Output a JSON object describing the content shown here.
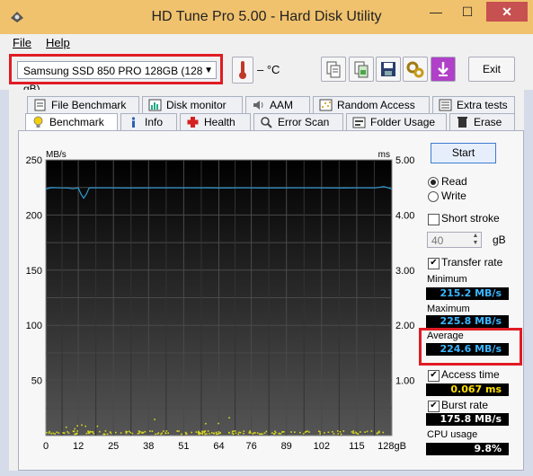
{
  "window": {
    "title": "HD Tune Pro 5.00 - Hard Disk Utility",
    "minimize": "—",
    "maximize": "☐",
    "close": "✕"
  },
  "menu": {
    "file": "File",
    "help": "Help"
  },
  "toolbar": {
    "drive": "Samsung SSD 850 PRO 128GB (128 gB)",
    "temperature": "– °C",
    "exit_label": "Exit",
    "icons": [
      "copy-text-icon",
      "copy-screenshot-icon",
      "save-icon",
      "options-icon",
      "download-icon"
    ]
  },
  "tabs_row1": [
    {
      "label": "File Benchmark",
      "icon": "file-benchmark-icon"
    },
    {
      "label": "Disk monitor",
      "icon": "disk-monitor-icon"
    },
    {
      "label": "AAM",
      "icon": "speaker-icon"
    },
    {
      "label": "Random Access",
      "icon": "random-access-icon"
    },
    {
      "label": "Extra tests",
      "icon": "extra-tests-icon"
    }
  ],
  "tabs_row2": [
    {
      "label": "Benchmark",
      "icon": "lightbulb-icon",
      "active": true
    },
    {
      "label": "Info",
      "icon": "info-icon"
    },
    {
      "label": "Health",
      "icon": "health-cross-icon"
    },
    {
      "label": "Error Scan",
      "icon": "error-scan-icon"
    },
    {
      "label": "Folder Usage",
      "icon": "folder-icon"
    },
    {
      "label": "Erase",
      "icon": "trash-icon"
    }
  ],
  "controls": {
    "start": "Start",
    "read": "Read",
    "write": "Write",
    "short_stroke": "Short stroke",
    "short_stroke_value": "40",
    "short_stroke_unit": "gB",
    "transfer_rate": "Transfer rate",
    "access_time": "Access time",
    "burst_rate": "Burst rate"
  },
  "stats": {
    "minimum_label": "Minimum",
    "minimum": "215.2 MB/s",
    "maximum_label": "Maximum",
    "maximum": "225.8 MB/s",
    "average_label": "Average",
    "average": "224.6 MB/s",
    "access_time": "0.067 ms",
    "burst_rate": "175.8 MB/s",
    "cpu_label": "CPU usage",
    "cpu": "9.8%"
  },
  "colors": {
    "transfer_line": "#2e9bd6",
    "access_dots": "#d8d820",
    "highlight": "#e01b24",
    "chart_bg": "#0b0b0b"
  },
  "chart_data": {
    "type": "line",
    "left_unit": "MB/s",
    "right_unit": "ms",
    "y_left_ticks": [
      "250",
      "200",
      "150",
      "100",
      "50"
    ],
    "y_left_range": [
      0,
      250
    ],
    "y_right_ticks": [
      "5.00",
      "4.00",
      "3.00",
      "2.00",
      "1.00"
    ],
    "y_right_range": [
      0,
      5
    ],
    "x_ticks": [
      "0",
      "12",
      "25",
      "38",
      "51",
      "64",
      "76",
      "89",
      "102",
      "115",
      "128gB"
    ],
    "x_range": [
      0,
      128
    ],
    "series": [
      {
        "x": [
          0,
          2,
          5,
          8,
          10,
          12,
          13,
          14,
          15,
          16,
          17,
          20,
          25,
          30,
          38,
          45,
          51,
          60,
          64,
          70,
          76,
          80,
          89,
          95,
          102,
          108,
          115,
          122,
          125,
          128
        ],
        "y": [
          223.5,
          224.8,
          224.6,
          224.5,
          223.8,
          224.6,
          219,
          215.2,
          219,
          224.5,
          224.7,
          224.6,
          224.6,
          224.5,
          224.6,
          224.6,
          224.6,
          224.7,
          224.5,
          224.6,
          224.6,
          224.5,
          224.6,
          224.6,
          224.6,
          224.5,
          224.6,
          224.6,
          225.8,
          223.6
        ]
      }
    ],
    "access_time_ms_typical": 0.067,
    "grid": true
  }
}
